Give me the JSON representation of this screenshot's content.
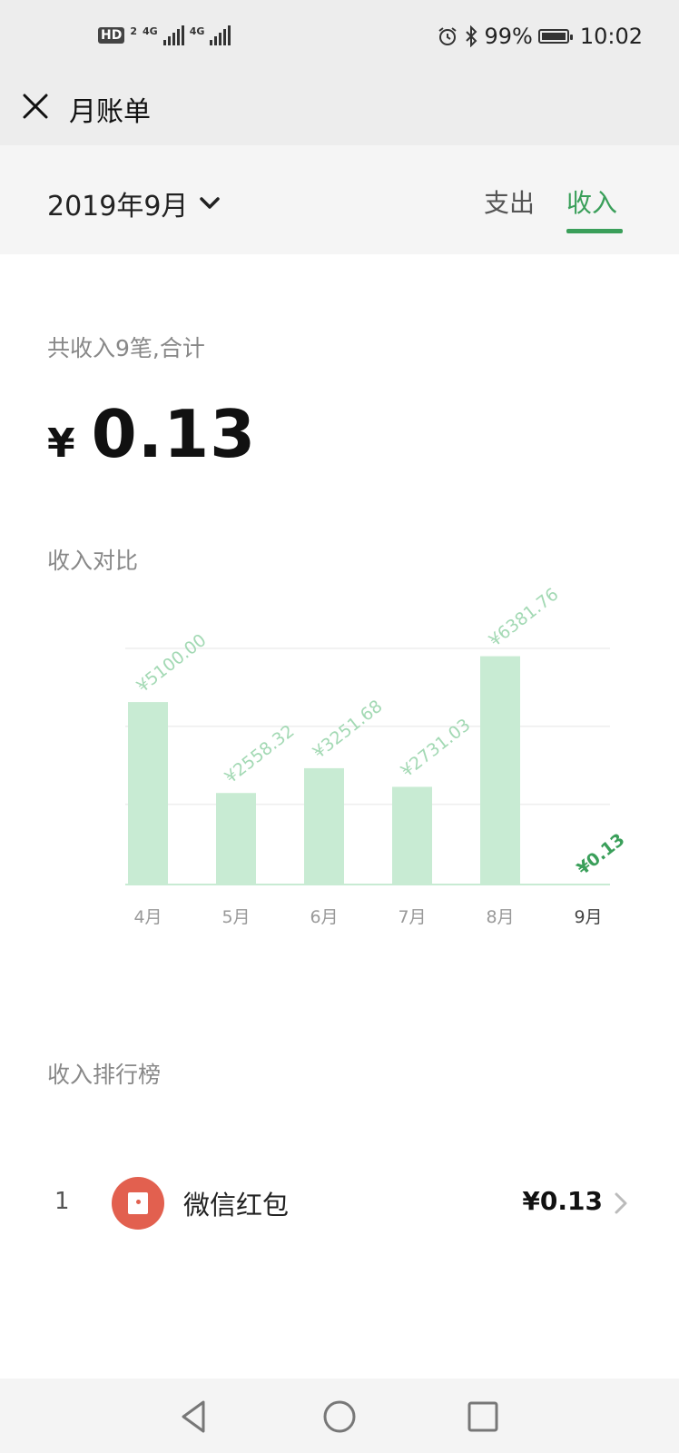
{
  "status_bar": {
    "hd_label": "HD",
    "hd_sub": "2",
    "signal_1_label": "4G",
    "signal_2_label": "4G",
    "battery_percent": "99%",
    "battery_level": 0.99,
    "time": "10:02"
  },
  "nav": {
    "title": "月账单",
    "close_icon": "close-icon"
  },
  "filter": {
    "month": "2019年9月",
    "tabs": [
      {
        "label": "支出",
        "active": false
      },
      {
        "label": "收入",
        "active": true
      }
    ]
  },
  "summary": {
    "label": "共收入9笔,合计",
    "currency": "¥",
    "amount": "0.13"
  },
  "comparison": {
    "title": "收入对比"
  },
  "chart_data": {
    "type": "bar",
    "categories": [
      "4月",
      "5月",
      "6月",
      "7月",
      "8月",
      "9月"
    ],
    "values": [
      5100.0,
      2558.32,
      3251.68,
      2731.03,
      6381.76,
      0.13
    ],
    "labels": [
      "¥5100.00",
      "¥2558.32",
      "¥3251.68",
      "¥2731.03",
      "¥6381.76",
      "¥0.13"
    ],
    "ylim": [
      0,
      6600
    ],
    "grid": true,
    "highlight_index": 5,
    "colors": {
      "bar": "#c8ebd3",
      "label": "#a3d9b4",
      "highlight_label": "#3a9f5a",
      "gridline": "#eeeeee",
      "axis": "#c8ebd3"
    }
  },
  "ranking": {
    "title": "收入排行榜",
    "items": [
      {
        "rank": "1",
        "name": "微信红包",
        "amount": "¥0.13",
        "icon": "red-envelope-icon"
      }
    ]
  },
  "colors": {
    "accent": "#3a9f5a",
    "header_bg": "#ededed",
    "filter_bg": "#f5f5f5",
    "avatar_red": "#e2604f"
  }
}
